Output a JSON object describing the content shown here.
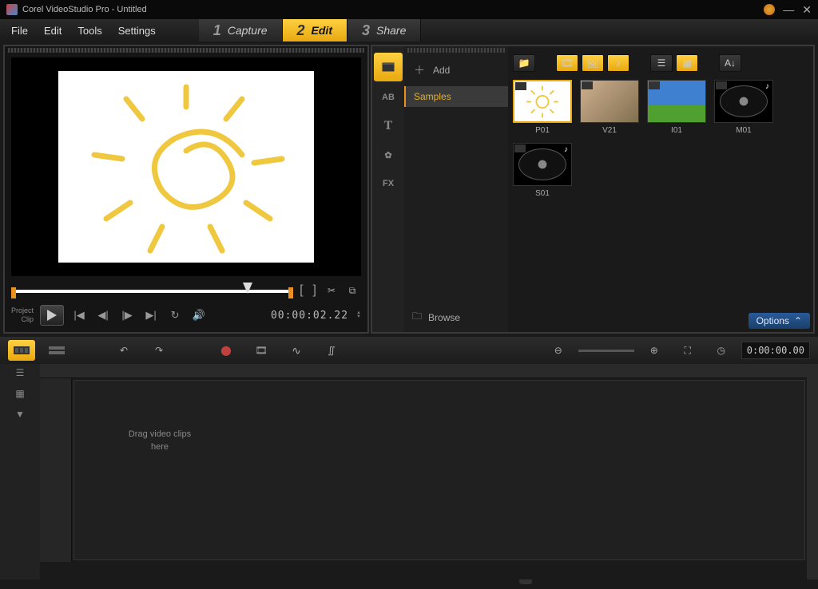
{
  "title": "Corel VideoStudio Pro - Untitled",
  "menu": {
    "file": "File",
    "edit": "Edit",
    "tools": "Tools",
    "settings": "Settings"
  },
  "steps": [
    {
      "num": "1",
      "label": "Capture",
      "active": false
    },
    {
      "num": "2",
      "label": "Edit",
      "active": true
    },
    {
      "num": "3",
      "label": "Share",
      "active": false
    }
  ],
  "preview": {
    "project_label": "Project",
    "clip_label": "Clip",
    "timecode": "00:00:02.22"
  },
  "library": {
    "add_label": "Add",
    "folder_label": "Samples",
    "browse_label": "Browse",
    "options_label": "Options",
    "thumbs": [
      {
        "id": "P01",
        "kind": "project"
      },
      {
        "id": "V21",
        "kind": "video"
      },
      {
        "id": "I01",
        "kind": "image"
      },
      {
        "id": "M01",
        "kind": "audio"
      },
      {
        "id": "S01",
        "kind": "audio"
      }
    ]
  },
  "library_tabs": [
    {
      "name": "media",
      "icon": "film",
      "active": true
    },
    {
      "name": "transition",
      "icon": "AB",
      "active": false
    },
    {
      "name": "title",
      "icon": "T",
      "active": false
    },
    {
      "name": "graphic",
      "icon": "flower",
      "active": false
    },
    {
      "name": "filter",
      "icon": "FX",
      "active": false
    }
  ],
  "timeline": {
    "timecode": "0:00:00.00",
    "drop_hint": "Drag video clips here"
  }
}
